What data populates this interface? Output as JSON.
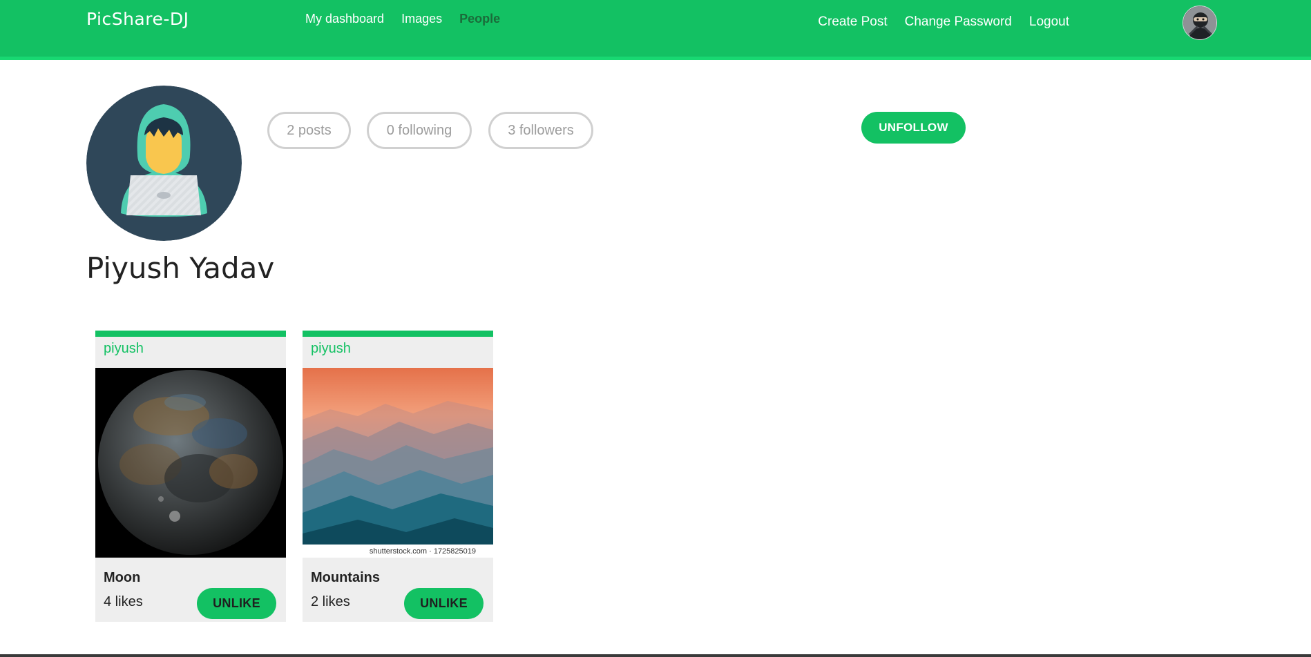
{
  "navbar": {
    "brand": "PicShare-DJ",
    "links": [
      "My dashboard",
      "Images",
      "People"
    ],
    "active_link": "People",
    "right_links": [
      "Create Post",
      "Change Password",
      "Logout"
    ],
    "accent_color": "#13c163"
  },
  "profile": {
    "name": "Piyush Yadav",
    "stats": {
      "posts": "2 posts",
      "following": "0 following",
      "followers": "3 followers"
    },
    "follow_button": "UNFOLLOW"
  },
  "posts": [
    {
      "author": "piyush",
      "title": "Moon",
      "likes": "4 likes",
      "button": "UNLIKE",
      "image": "moon-photo"
    },
    {
      "author": "piyush",
      "title": "Mountains",
      "likes": "2 likes",
      "button": "UNLIKE",
      "image": "mountains-photo",
      "watermark": "shutterstock.com · 1725825019"
    }
  ]
}
